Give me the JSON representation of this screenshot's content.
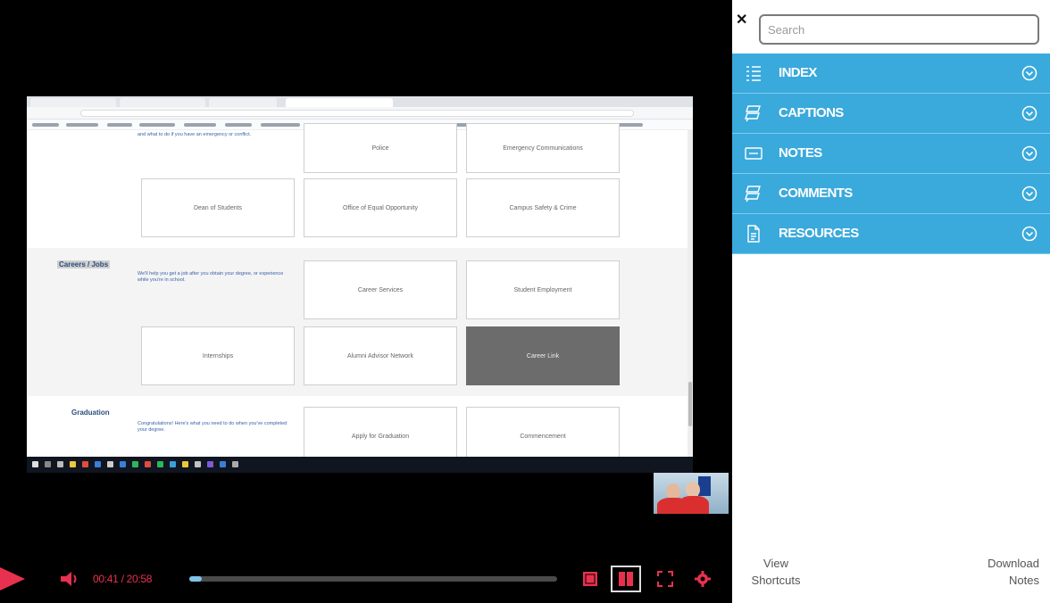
{
  "player": {
    "time": "00:41 / 20:58",
    "progress_fraction": 0.035
  },
  "embedded_page": {
    "top_row_desc": "and what to do if you have an emergency or conflict.",
    "top_cards": [
      "Police",
      "Emergency Communications"
    ],
    "row1": [
      "Dean of Students",
      "Office of Equal Opportunity",
      "Campus Safety & Crime"
    ],
    "careers": {
      "title": "Careers / Jobs",
      "desc": "We'll help you get a job after you obtain your degree, or experience while you're in school.",
      "cards": [
        "Career Services",
        "Student Employment",
        "Internships",
        "Alumni Advisor Network",
        "Career Link"
      ]
    },
    "graduation": {
      "title": "Graduation",
      "desc": "Congratulations! Here's what you need to do when you've completed your degree.",
      "cards": [
        "Apply for Graduation",
        "Commencement"
      ]
    }
  },
  "panel": {
    "search_placeholder": "Search",
    "sections": [
      {
        "label": "INDEX",
        "icon": "list-icon"
      },
      {
        "label": "CAPTIONS",
        "icon": "captions-icon"
      },
      {
        "label": "NOTES",
        "icon": "notes-icon"
      },
      {
        "label": "COMMENTS",
        "icon": "comments-icon"
      },
      {
        "label": "RESOURCES",
        "icon": "resources-icon"
      }
    ],
    "view_shortcuts": "View Shortcuts",
    "download_notes": "Download Notes"
  },
  "colors": {
    "accent": "#3aa9dc",
    "player_red": "#e8314f",
    "progress_fill": "#7fc4e8"
  }
}
